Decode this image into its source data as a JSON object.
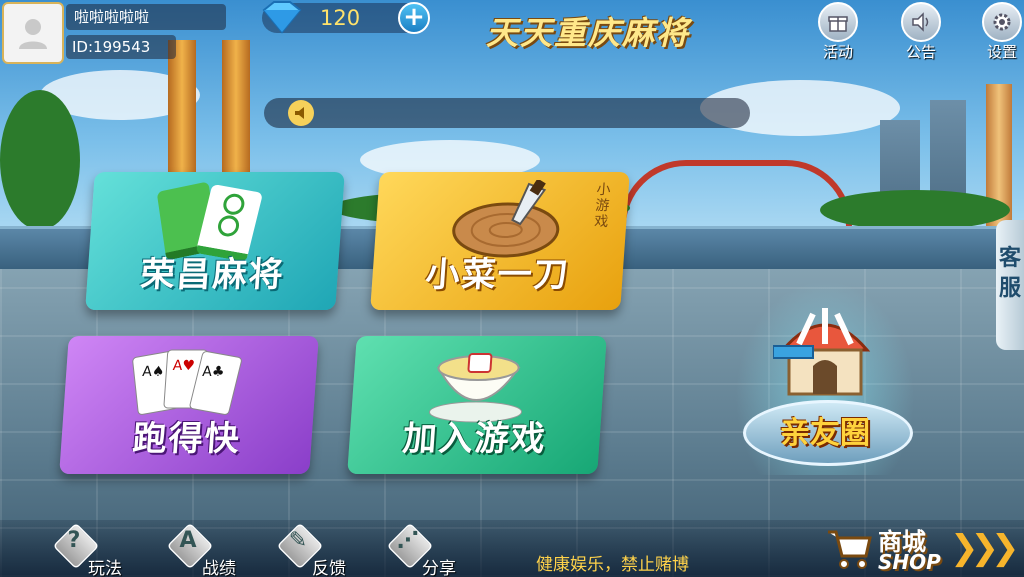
{
  "user": {
    "name": "啦啦啦啦啦",
    "id": "ID:199543",
    "diamonds": "120"
  },
  "header": {
    "title": "天天重庆麻将",
    "buttons": [
      {
        "label": "活动",
        "icon": "gift-icon"
      },
      {
        "label": "公告",
        "icon": "speaker-icon"
      },
      {
        "label": "设置",
        "icon": "gear-icon"
      }
    ]
  },
  "notice": {
    "text": ""
  },
  "games": {
    "rongchang": {
      "label": "荣昌麻将"
    },
    "xiaocai": {
      "label": "小菜一刀",
      "tag": "小游戏"
    },
    "paodekuai": {
      "label": "跑得快"
    },
    "join": {
      "label": "加入游戏"
    },
    "friends": {
      "label": "亲友圈"
    }
  },
  "service": {
    "label": "客服"
  },
  "footer": {
    "buttons": [
      {
        "label": "玩法",
        "icon": "question-icon",
        "glyph": "?"
      },
      {
        "label": "战绩",
        "icon": "medal-icon",
        "glyph": "A"
      },
      {
        "label": "反馈",
        "icon": "pencil-icon",
        "glyph": "✎"
      },
      {
        "label": "分享",
        "icon": "share-icon",
        "glyph": "⋰"
      }
    ],
    "health_notice": "健康娱乐，禁止赌博",
    "shop": {
      "label_cn": "商城",
      "label_en": "SHOP"
    }
  },
  "colors": {
    "accent_gold": "#ffe88a",
    "diamond_count": "#ffe26b",
    "health_notice": "#ffd24a"
  }
}
